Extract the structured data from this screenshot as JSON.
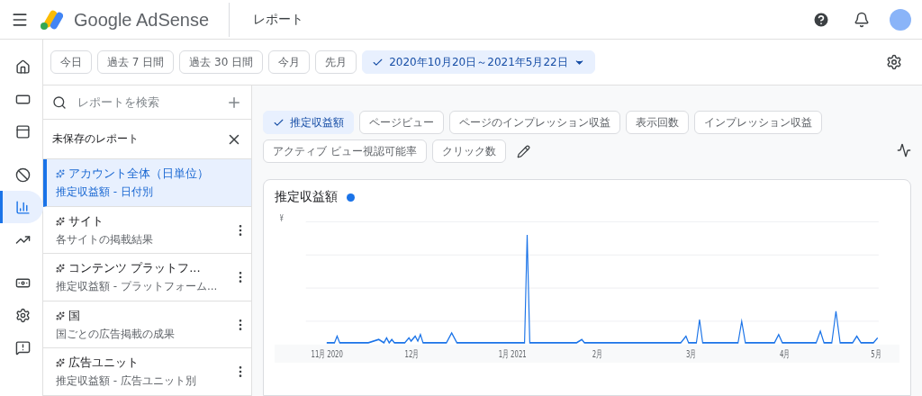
{
  "header": {
    "product": "Google AdSense",
    "page_title": "レポート"
  },
  "rail": [
    {
      "selected": false
    },
    {
      "selected": false
    },
    {
      "selected": false
    },
    {
      "selected": false
    },
    {
      "selected": true
    },
    {
      "selected": false
    },
    {
      "selected": false
    },
    {
      "selected": false
    },
    {
      "selected": false
    }
  ],
  "date_presets": [
    {
      "label": "今日",
      "selected": false
    },
    {
      "label": "過去 7 日間",
      "selected": false
    },
    {
      "label": "過去 30 日間",
      "selected": false
    },
    {
      "label": "今月",
      "selected": false
    },
    {
      "label": "先月",
      "selected": false
    },
    {
      "label": "2020年10月20日～2021年5月22日",
      "selected": true
    }
  ],
  "report_search": {
    "placeholder": "レポートを検索"
  },
  "unsaved_report": "未保存のレポート",
  "reports": [
    {
      "title": "アカウント全体（日単位）",
      "subtitle": "推定収益額 - 日付別",
      "selected": true
    },
    {
      "title": "サイト",
      "subtitle": "各サイトの掲載結果",
      "selected": false
    },
    {
      "title": "コンテンツ プラットフ...",
      "subtitle": "推定収益額 - プラットフォーム...",
      "selected": false
    },
    {
      "title": "国",
      "subtitle": "国ごとの広告掲載の成果",
      "selected": false
    },
    {
      "title": "広告ユニット",
      "subtitle": "推定収益額 - 広告ユニット別",
      "selected": false
    }
  ],
  "metrics": [
    {
      "label": "推定収益額",
      "selected": true
    },
    {
      "label": "ページビュー",
      "selected": false
    },
    {
      "label": "ページのインプレッション収益",
      "selected": false
    },
    {
      "label": "表示回数",
      "selected": false
    },
    {
      "label": "インプレッション収益",
      "selected": false
    },
    {
      "label": "アクティブ ビュー視認可能率",
      "selected": false
    },
    {
      "label": "クリック数",
      "selected": false
    }
  ],
  "chart": {
    "title": "推定収益額",
    "color": "#1a73e8",
    "y_unit": "¥",
    "x_labels": [
      "11月 2020",
      "12月",
      "1月 2021",
      "2月",
      "3月",
      "4月",
      "5月"
    ]
  }
}
